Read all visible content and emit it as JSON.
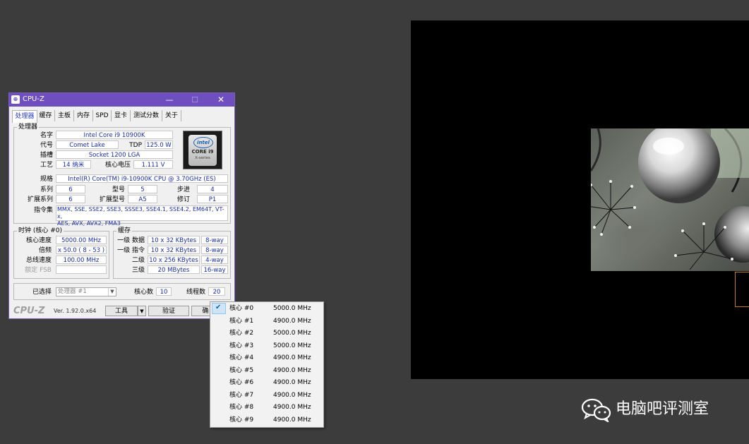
{
  "cpuz": {
    "title": "CPU-Z",
    "window_buttons": {
      "minimize": "—",
      "maximize": "☐",
      "close": "✕"
    },
    "tabs": [
      "处理器",
      "缓存",
      "主板",
      "内存",
      "SPD",
      "显卡",
      "测试分数",
      "关于"
    ],
    "active_tab": "处理器",
    "processor": {
      "group_title": "处理器",
      "name_label": "名字",
      "name": "Intel Core i9 10900K",
      "codename_label": "代号",
      "codename": "Comet Lake",
      "tdp_label": "TDP",
      "tdp": "125.0 W",
      "package_label": "插槽",
      "package": "Socket 1200 LGA",
      "tech_label": "工艺",
      "tech": "14 纳米",
      "voltage_label": "核心电压",
      "voltage": "1.111 V",
      "spec_label": "规格",
      "spec": "Intel(R) Core(TM) i9-10900K CPU @ 3.70GHz (ES)",
      "family_label": "系列",
      "family": "6",
      "model_label": "型号",
      "model": "5",
      "stepping_label": "步进",
      "stepping": "4",
      "ext_family_label": "扩展系列",
      "ext_family": "6",
      "ext_model_label": "扩展型号",
      "ext_model": "A5",
      "revision_label": "修订",
      "revision": "P1",
      "instructions_label": "指令集",
      "instructions_line1": "MMX, SSE, SSE2, SSE3, SSSE3, SSE4.1, SSE4.2, EM64T, VT-x,",
      "instructions_line2": "AES, AVX, AVX2, FMA3",
      "logo": {
        "brand": "intel",
        "line1": "CORE i9",
        "line2": "X-series"
      }
    },
    "clocks": {
      "group_title": "时钟 (核心 #0)",
      "core_speed_label": "核心速度",
      "core_speed": "5000.00 MHz",
      "multiplier_label": "倍频",
      "multiplier": "x 50.0 ( 8 - 53 )",
      "bus_speed_label": "总线速度",
      "bus_speed": "100.00 MHz",
      "fsb_label": "额定 FSB",
      "fsb": ""
    },
    "cache": {
      "group_title": "缓存",
      "l1d_label": "一级 数据",
      "l1d": "10 x 32 KBytes",
      "l1d_way": "8-way",
      "l1i_label": "一级 指令",
      "l1i": "10 x 32 KBytes",
      "l1i_way": "8-way",
      "l2_label": "二级",
      "l2": "10 x 256 KBytes",
      "l2_way": "4-way",
      "l3_label": "三级",
      "l3": "20 MBytes",
      "l3_way": "16-way"
    },
    "selection": {
      "selected_label": "已选择",
      "selected": "处理器 #1",
      "cores_label": "核心数",
      "cores": "10",
      "threads_label": "线程数",
      "threads": "20"
    },
    "footer": {
      "brand": "CPU-Z",
      "version": "Ver. 1.92.0.x64",
      "tools_label": "工具",
      "validate_label": "验证",
      "ok_label": "确"
    }
  },
  "core_menu": {
    "items": [
      {
        "core": "核心 #0",
        "freq": "5000.0 MHz",
        "checked": true
      },
      {
        "core": "核心 #1",
        "freq": "4900.0 MHz"
      },
      {
        "core": "核心 #2",
        "freq": "5000.0 MHz"
      },
      {
        "core": "核心 #3",
        "freq": "5000.0 MHz"
      },
      {
        "core": "核心 #4",
        "freq": "4900.0 MHz"
      },
      {
        "core": "核心 #5",
        "freq": "4900.0 MHz"
      },
      {
        "core": "核心 #6",
        "freq": "4900.0 MHz"
      },
      {
        "core": "核心 #7",
        "freq": "4900.0 MHz"
      },
      {
        "core": "核心 #8",
        "freq": "4900.0 MHz"
      },
      {
        "core": "核心 #9",
        "freq": "4900.0 MHz"
      }
    ]
  },
  "watermark": {
    "icon": "wechat-icon",
    "text": "电脑吧评测室"
  },
  "colors": {
    "titlebar": "#6f4fbf",
    "value_text": "#1a2fa8",
    "background": "#3c3c3c"
  }
}
